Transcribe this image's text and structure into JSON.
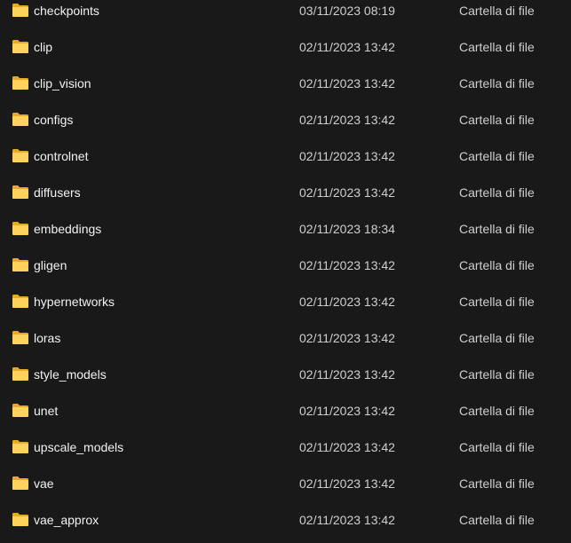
{
  "colors": {
    "background": "#191919",
    "folder_back": "#e8a92b",
    "folder_front": "#ffd35c",
    "text_primary": "#f2f2f2",
    "text_secondary": "#cfcfcf"
  },
  "items": [
    {
      "icon": "folder-icon",
      "name": "checkpoints",
      "date": "03/11/2023 08:19",
      "type": "Cartella di file"
    },
    {
      "icon": "folder-icon",
      "name": "clip",
      "date": "02/11/2023 13:42",
      "type": "Cartella di file"
    },
    {
      "icon": "folder-icon",
      "name": "clip_vision",
      "date": "02/11/2023 13:42",
      "type": "Cartella di file"
    },
    {
      "icon": "folder-icon",
      "name": "configs",
      "date": "02/11/2023 13:42",
      "type": "Cartella di file"
    },
    {
      "icon": "folder-icon",
      "name": "controlnet",
      "date": "02/11/2023 13:42",
      "type": "Cartella di file"
    },
    {
      "icon": "folder-icon",
      "name": "diffusers",
      "date": "02/11/2023 13:42",
      "type": "Cartella di file"
    },
    {
      "icon": "folder-icon",
      "name": "embeddings",
      "date": "02/11/2023 18:34",
      "type": "Cartella di file"
    },
    {
      "icon": "folder-icon",
      "name": "gligen",
      "date": "02/11/2023 13:42",
      "type": "Cartella di file"
    },
    {
      "icon": "folder-icon",
      "name": "hypernetworks",
      "date": "02/11/2023 13:42",
      "type": "Cartella di file"
    },
    {
      "icon": "folder-icon",
      "name": "loras",
      "date": "02/11/2023 13:42",
      "type": "Cartella di file"
    },
    {
      "icon": "folder-icon",
      "name": "style_models",
      "date": "02/11/2023 13:42",
      "type": "Cartella di file"
    },
    {
      "icon": "folder-icon",
      "name": "unet",
      "date": "02/11/2023 13:42",
      "type": "Cartella di file"
    },
    {
      "icon": "folder-icon",
      "name": "upscale_models",
      "date": "02/11/2023 13:42",
      "type": "Cartella di file"
    },
    {
      "icon": "folder-icon",
      "name": "vae",
      "date": "02/11/2023 13:42",
      "type": "Cartella di file"
    },
    {
      "icon": "folder-icon",
      "name": "vae_approx",
      "date": "02/11/2023 13:42",
      "type": "Cartella di file"
    }
  ]
}
